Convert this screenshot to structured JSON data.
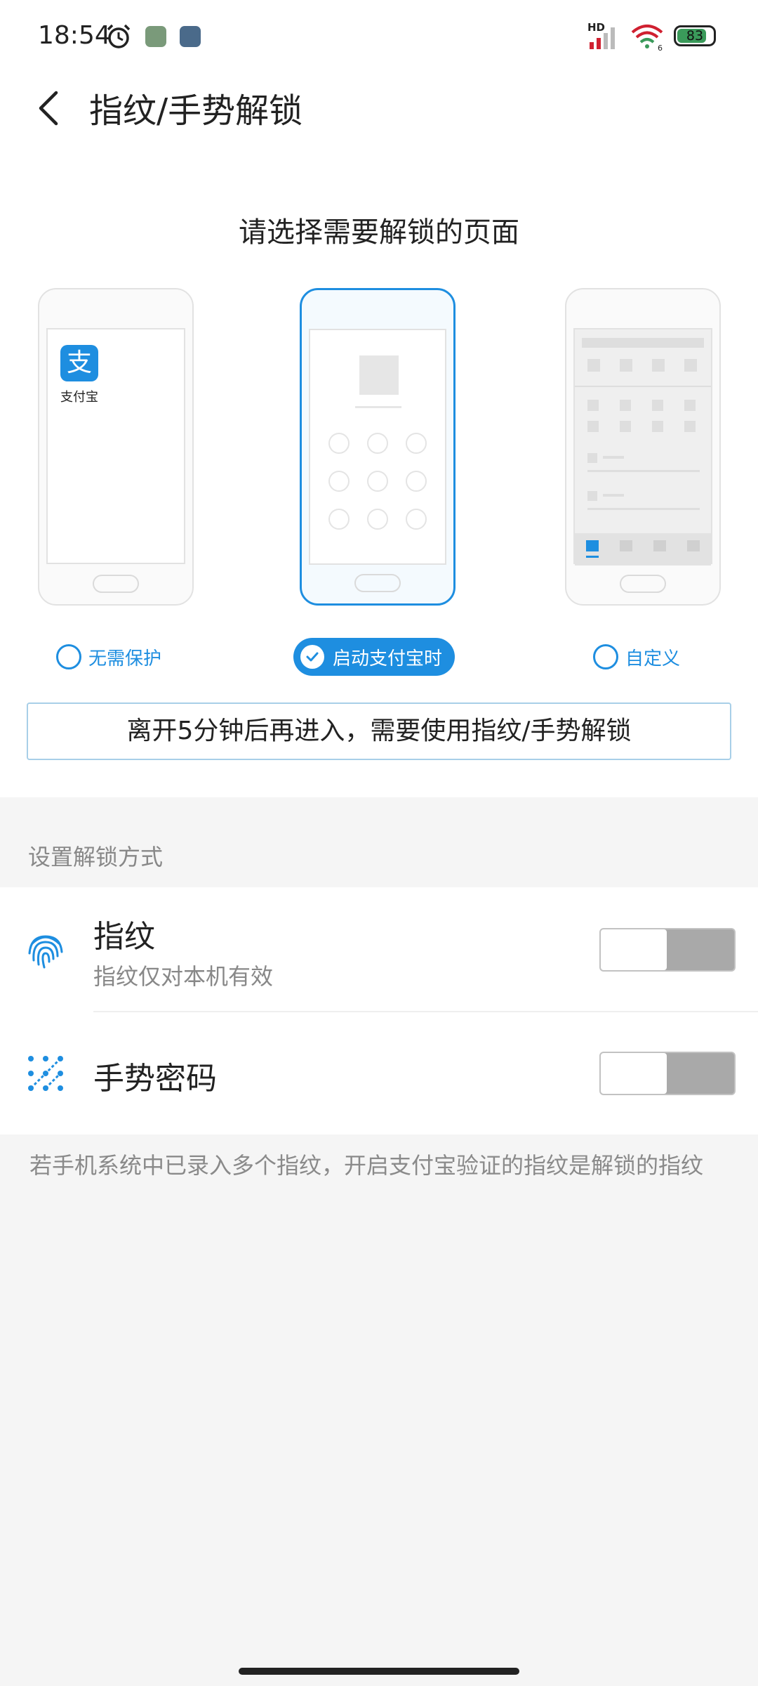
{
  "status_bar": {
    "time": "18:54",
    "network_label": "HD",
    "wifi_sub": "6",
    "battery": "83",
    "battery_level_percent": 83,
    "icons": [
      "alarm-icon",
      "app-icon",
      "app-icon",
      "signal-icon",
      "wifi-icon",
      "battery-icon"
    ]
  },
  "header": {
    "back_icon": "chevron-left-icon",
    "title": "指纹/手势解锁"
  },
  "chooser": {
    "title": "请选择需要解锁的页面",
    "alipay_label": "支付宝",
    "options": [
      {
        "label": "无需保护",
        "selected": false
      },
      {
        "label": "启动支付宝时",
        "selected": true
      },
      {
        "label": "自定义",
        "selected": false
      }
    ],
    "hint": "离开5分钟后再进入，需要使用指纹/手势解锁"
  },
  "unlock_methods": {
    "section_label": "设置解锁方式",
    "items": [
      {
        "icon": "fingerprint-icon",
        "title": "指纹",
        "subtitle": "指纹仅对本机有效",
        "enabled": false
      },
      {
        "icon": "gesture-pattern-icon",
        "title": "手势密码",
        "enabled": false
      }
    ]
  },
  "footnote": "若手机系统中已录入多个指纹，开启支付宝验证的指纹是解锁的指纹",
  "colors": {
    "accent": "#1e8ee0",
    "toggle_off": "#a9a9a9",
    "background": "#f5f5f5"
  }
}
